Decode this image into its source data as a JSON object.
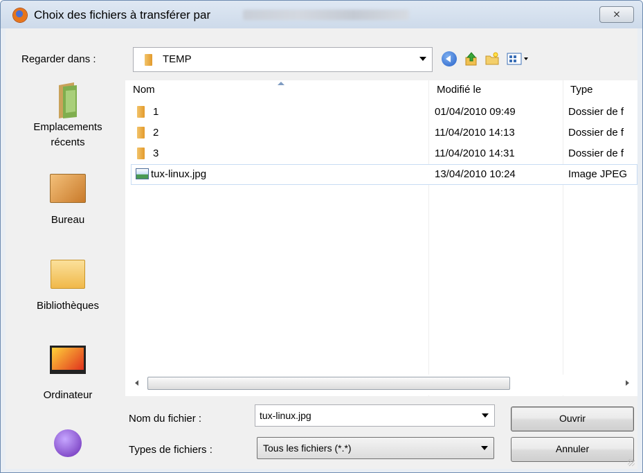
{
  "window": {
    "title": "Choix des fichiers à transférer par",
    "close_glyph": "⨯"
  },
  "toolbar": {
    "look_in_label": "Regarder dans :",
    "look_in_value": "TEMP",
    "icons": [
      "back-icon",
      "up-folder-icon",
      "new-folder-icon",
      "views-menu-icon"
    ]
  },
  "places": [
    {
      "label": "Emplacements récents",
      "icon": "recent-places-icon"
    },
    {
      "label": "Bureau",
      "icon": "desktop-icon"
    },
    {
      "label": "Bibliothèques",
      "icon": "libraries-icon"
    },
    {
      "label": "Ordinateur",
      "icon": "computer-icon"
    },
    {
      "label": "",
      "icon": "network-icon"
    }
  ],
  "file_list": {
    "columns": {
      "name": "Nom",
      "modified": "Modifié le",
      "type": "Type"
    },
    "rows": [
      {
        "name": "1",
        "modified": "01/04/2010 09:49",
        "type": "Dossier de f",
        "icon": "folder-icon"
      },
      {
        "name": "2",
        "modified": "11/04/2010 14:13",
        "type": "Dossier de f",
        "icon": "folder-icon"
      },
      {
        "name": "3",
        "modified": "11/04/2010 14:31",
        "type": "Dossier de f",
        "icon": "folder-icon"
      },
      {
        "name": "tux-linux.jpg",
        "modified": "13/04/2010 10:24",
        "type": "Image JPEG",
        "icon": "image-file-icon",
        "selected": true
      }
    ]
  },
  "form": {
    "filename_label": "Nom du fichier :",
    "filename_value": "tux-linux.jpg",
    "filetype_label": "Types de fichiers :",
    "filetype_value": "Tous les fichiers (*.*)",
    "open_button": "Ouvrir",
    "cancel_button": "Annuler"
  },
  "colors": {
    "title_bar": "#dfe8f3",
    "dialog_bg": "#f0f0f0",
    "selection_border": "#c8dcf3"
  }
}
